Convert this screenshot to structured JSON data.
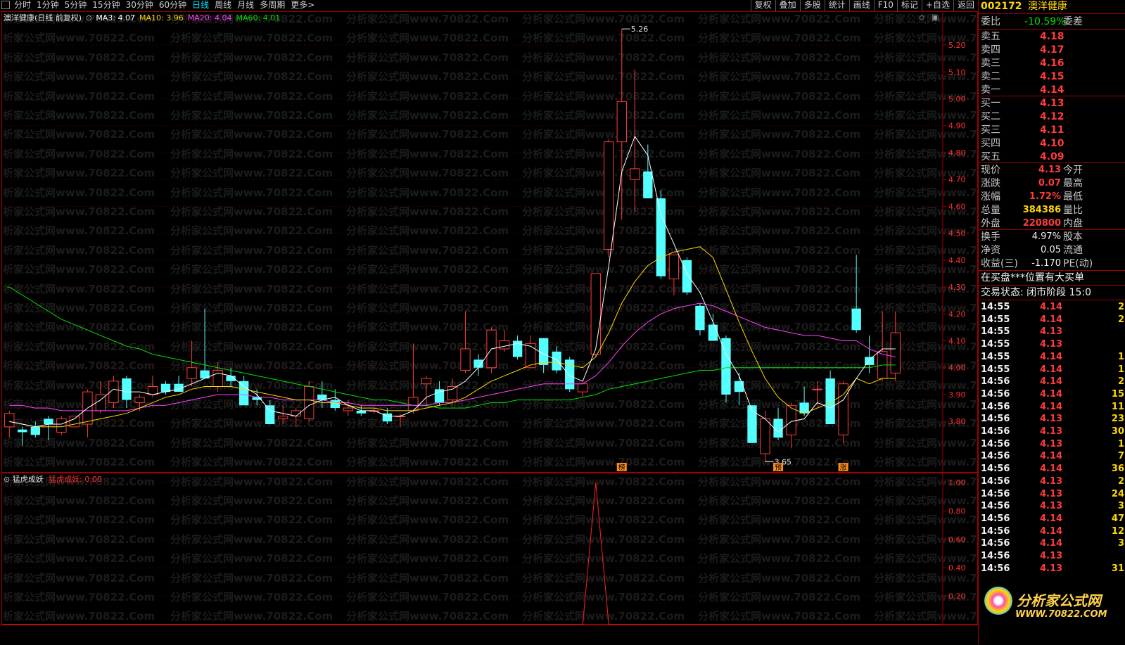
{
  "toolbar": {
    "periods": [
      "分时",
      "1分钟",
      "5分钟",
      "15分钟",
      "30分钟",
      "60分钟",
      "日线",
      "周线",
      "月线",
      "多周期",
      "更多>"
    ],
    "active_period": "日线",
    "tools": [
      "复权",
      "叠加",
      "多股",
      "统计",
      "画线",
      "F10",
      "标记",
      "+自选",
      "返回"
    ]
  },
  "main_chart": {
    "title": "澳洋健康(日线 前复权)",
    "ma_labels": [
      {
        "text": "MA3: 4.07",
        "color": "#ffffff"
      },
      {
        "text": "MA10: 3.96",
        "color": "#ffd700"
      },
      {
        "text": "MA20: 4.04",
        "color": "#ff40ff"
      },
      {
        "text": "MA60: 4.01",
        "color": "#00e000"
      }
    ],
    "y_ticks": [
      "5.20",
      "5.10",
      "5.00",
      "4.90",
      "4.80",
      "4.70",
      "4.60",
      "4.50",
      "4.40",
      "4.30",
      "4.20",
      "4.10",
      "4.00",
      "3.90",
      "3.80"
    ],
    "high_mark": "5.26",
    "low_mark": "3.65",
    "markers": [
      "榜",
      "预",
      "涨"
    ]
  },
  "indicator": {
    "title": "猛虎成妖",
    "value_label": "猛虎成妖: 0.00",
    "y_ticks": [
      "1.00",
      "0.80",
      "0.60",
      "0.40",
      "0.20"
    ]
  },
  "chart_data": {
    "type": "candlestick",
    "ylim": [
      3.62,
      5.31
    ],
    "candles": [
      {
        "o": 3.78,
        "h": 3.84,
        "l": 3.74,
        "c": 3.83
      },
      {
        "o": 3.77,
        "h": 3.78,
        "l": 3.71,
        "c": 3.76
      },
      {
        "o": 3.78,
        "h": 3.8,
        "l": 3.74,
        "c": 3.75
      },
      {
        "o": 3.81,
        "h": 3.82,
        "l": 3.73,
        "c": 3.79
      },
      {
        "o": 3.76,
        "h": 3.82,
        "l": 3.75,
        "c": 3.81
      },
      {
        "o": 3.78,
        "h": 3.82,
        "l": 3.78,
        "c": 3.82
      },
      {
        "o": 3.79,
        "h": 3.92,
        "l": 3.74,
        "c": 3.91
      },
      {
        "o": 3.84,
        "h": 3.95,
        "l": 3.83,
        "c": 3.9
      },
      {
        "o": 3.87,
        "h": 3.97,
        "l": 3.85,
        "c": 3.95
      },
      {
        "o": 3.96,
        "h": 3.97,
        "l": 3.85,
        "c": 3.88
      },
      {
        "o": 3.87,
        "h": 3.9,
        "l": 3.84,
        "c": 3.89
      },
      {
        "o": 3.9,
        "h": 3.97,
        "l": 3.89,
        "c": 3.93
      },
      {
        "o": 3.94,
        "h": 3.95,
        "l": 3.9,
        "c": 3.91
      },
      {
        "o": 3.94,
        "h": 3.97,
        "l": 3.91,
        "c": 3.91
      },
      {
        "o": 3.96,
        "h": 4.1,
        "l": 3.93,
        "c": 4.0
      },
      {
        "o": 3.99,
        "h": 4.22,
        "l": 3.97,
        "c": 3.96
      },
      {
        "o": 3.93,
        "h": 4.02,
        "l": 3.91,
        "c": 3.99
      },
      {
        "o": 3.97,
        "h": 4.0,
        "l": 3.93,
        "c": 3.95
      },
      {
        "o": 3.95,
        "h": 3.97,
        "l": 3.87,
        "c": 3.86
      },
      {
        "o": 3.89,
        "h": 3.92,
        "l": 3.86,
        "c": 3.88
      },
      {
        "o": 3.86,
        "h": 3.88,
        "l": 3.79,
        "c": 3.79
      },
      {
        "o": 3.81,
        "h": 3.86,
        "l": 3.79,
        "c": 3.82
      },
      {
        "o": 3.82,
        "h": 3.85,
        "l": 3.78,
        "c": 3.84
      },
      {
        "o": 3.81,
        "h": 3.95,
        "l": 3.8,
        "c": 3.93
      },
      {
        "o": 3.9,
        "h": 3.95,
        "l": 3.85,
        "c": 3.88
      },
      {
        "o": 3.88,
        "h": 3.92,
        "l": 3.84,
        "c": 3.85
      },
      {
        "o": 3.84,
        "h": 3.88,
        "l": 3.82,
        "c": 3.85
      },
      {
        "o": 3.84,
        "h": 3.86,
        "l": 3.82,
        "c": 3.83
      },
      {
        "o": 3.84,
        "h": 3.85,
        "l": 3.83,
        "c": 3.84
      },
      {
        "o": 3.83,
        "h": 3.85,
        "l": 3.79,
        "c": 3.8
      },
      {
        "o": 3.82,
        "h": 3.83,
        "l": 3.78,
        "c": 3.82
      },
      {
        "o": 3.84,
        "h": 4.09,
        "l": 3.83,
        "c": 3.89
      },
      {
        "o": 3.94,
        "h": 3.97,
        "l": 3.86,
        "c": 3.96
      },
      {
        "o": 3.92,
        "h": 3.95,
        "l": 3.86,
        "c": 3.87
      },
      {
        "o": 3.88,
        "h": 3.96,
        "l": 3.86,
        "c": 3.93
      },
      {
        "o": 3.99,
        "h": 4.21,
        "l": 3.98,
        "c": 4.07
      },
      {
        "o": 4.03,
        "h": 4.05,
        "l": 3.97,
        "c": 4.0
      },
      {
        "o": 4.0,
        "h": 4.15,
        "l": 3.98,
        "c": 4.14
      },
      {
        "o": 4.07,
        "h": 4.14,
        "l": 4.06,
        "c": 4.1
      },
      {
        "o": 4.1,
        "h": 4.12,
        "l": 4.03,
        "c": 4.04
      },
      {
        "o": 4.0,
        "h": 4.12,
        "l": 4.01,
        "c": 4.09
      },
      {
        "o": 4.11,
        "h": 4.11,
        "l": 3.98,
        "c": 4.01
      },
      {
        "o": 4.06,
        "h": 4.08,
        "l": 3.98,
        "c": 3.99
      },
      {
        "o": 4.03,
        "h": 4.04,
        "l": 3.91,
        "c": 3.92
      },
      {
        "o": 3.91,
        "h": 3.93,
        "l": 3.89,
        "c": 3.94
      },
      {
        "o": 4.05,
        "h": 4.35,
        "l": 4.04,
        "c": 4.35
      },
      {
        "o": 4.44,
        "h": 4.85,
        "l": 4.41,
        "c": 4.84
      },
      {
        "o": 4.84,
        "h": 5.26,
        "l": 4.55,
        "c": 4.99
      },
      {
        "o": 4.7,
        "h": 5.11,
        "l": 4.58,
        "c": 4.74
      },
      {
        "o": 4.73,
        "h": 4.83,
        "l": 4.65,
        "c": 4.63
      },
      {
        "o": 4.63,
        "h": 4.66,
        "l": 4.33,
        "c": 4.34
      },
      {
        "o": 4.33,
        "h": 4.36,
        "l": 4.27,
        "c": 4.42
      },
      {
        "o": 4.4,
        "h": 4.41,
        "l": 4.27,
        "c": 4.28
      },
      {
        "o": 4.23,
        "h": 4.24,
        "l": 4.12,
        "c": 4.14
      },
      {
        "o": 4.16,
        "h": 4.2,
        "l": 4.1,
        "c": 4.1
      },
      {
        "o": 4.11,
        "h": 4.12,
        "l": 3.87,
        "c": 3.9
      },
      {
        "o": 3.95,
        "h": 3.98,
        "l": 3.86,
        "c": 3.91
      },
      {
        "o": 3.86,
        "h": 3.86,
        "l": 3.74,
        "c": 3.72
      },
      {
        "o": 3.68,
        "h": 3.84,
        "l": 3.65,
        "c": 3.81
      },
      {
        "o": 3.81,
        "h": 3.85,
        "l": 3.73,
        "c": 3.74
      },
      {
        "o": 3.75,
        "h": 3.87,
        "l": 3.7,
        "c": 3.86
      },
      {
        "o": 3.87,
        "h": 3.93,
        "l": 3.82,
        "c": 3.83
      },
      {
        "o": 3.92,
        "h": 3.95,
        "l": 3.86,
        "c": 3.92
      },
      {
        "o": 3.96,
        "h": 3.99,
        "l": 3.82,
        "c": 3.79
      },
      {
        "o": 3.75,
        "h": 3.95,
        "l": 3.72,
        "c": 3.94
      },
      {
        "o": 4.22,
        "h": 4.42,
        "l": 4.13,
        "c": 4.14
      },
      {
        "o": 4.04,
        "h": 4.12,
        "l": 3.98,
        "c": 4.01
      },
      {
        "o": 3.96,
        "h": 4.21,
        "l": 3.95,
        "c": 4.06
      },
      {
        "o": 3.98,
        "h": 4.21,
        "l": 3.95,
        "c": 4.13
      }
    ],
    "ma3": [
      3.8,
      3.79,
      3.78,
      3.79,
      3.79,
      3.81,
      3.85,
      3.88,
      3.92,
      3.91,
      3.91,
      3.9,
      3.91,
      3.92,
      3.94,
      3.96,
      3.98,
      3.97,
      3.93,
      3.9,
      3.84,
      3.83,
      3.82,
      3.86,
      3.88,
      3.89,
      3.86,
      3.84,
      3.84,
      3.82,
      3.82,
      3.84,
      3.89,
      3.91,
      3.92,
      3.95,
      4.0,
      4.07,
      4.08,
      4.09,
      4.08,
      4.05,
      4.03,
      3.97,
      3.95,
      4.07,
      4.38,
      4.73,
      4.86,
      4.79,
      4.57,
      4.46,
      4.35,
      4.28,
      4.17,
      4.05,
      3.97,
      3.84,
      3.81,
      3.76,
      3.8,
      3.81,
      3.87,
      3.85,
      3.88,
      3.96,
      4.03,
      4.07,
      4.07
    ],
    "ma10": [
      3.8,
      3.79,
      3.78,
      3.78,
      3.78,
      3.79,
      3.8,
      3.81,
      3.82,
      3.83,
      3.85,
      3.87,
      3.89,
      3.9,
      3.92,
      3.93,
      3.93,
      3.93,
      3.92,
      3.91,
      3.9,
      3.89,
      3.88,
      3.88,
      3.87,
      3.87,
      3.86,
      3.85,
      3.85,
      3.84,
      3.84,
      3.84,
      3.85,
      3.86,
      3.87,
      3.89,
      3.92,
      3.95,
      3.97,
      3.99,
      4.01,
      4.02,
      4.02,
      4.01,
      4.0,
      4.04,
      4.13,
      4.24,
      4.32,
      4.38,
      4.41,
      4.43,
      4.44,
      4.45,
      4.41,
      4.29,
      4.17,
      4.06,
      3.96,
      3.89,
      3.85,
      3.83,
      3.85,
      3.87,
      3.9,
      3.96,
      3.94,
      3.96,
      3.96
    ],
    "ma20": [
      3.86,
      3.86,
      3.85,
      3.85,
      3.84,
      3.84,
      3.84,
      3.84,
      3.84,
      3.84,
      3.85,
      3.86,
      3.86,
      3.87,
      3.88,
      3.89,
      3.9,
      3.9,
      3.9,
      3.89,
      3.89,
      3.88,
      3.88,
      3.88,
      3.88,
      3.87,
      3.87,
      3.86,
      3.86,
      3.86,
      3.86,
      3.86,
      3.86,
      3.87,
      3.87,
      3.88,
      3.89,
      3.9,
      3.91,
      3.92,
      3.93,
      3.94,
      3.94,
      3.94,
      3.94,
      3.97,
      4.02,
      4.08,
      4.13,
      4.17,
      4.2,
      4.22,
      4.23,
      4.24,
      4.23,
      4.21,
      4.19,
      4.17,
      4.15,
      4.14,
      4.13,
      4.12,
      4.12,
      4.11,
      4.1,
      4.1,
      4.07,
      4.05,
      4.04
    ],
    "ma60": [
      4.3,
      4.27,
      4.24,
      4.21,
      4.18,
      4.16,
      4.14,
      4.12,
      4.1,
      4.08,
      4.07,
      4.05,
      4.04,
      4.03,
      4.02,
      4.01,
      4.0,
      3.99,
      3.98,
      3.97,
      3.96,
      3.95,
      3.94,
      3.93,
      3.92,
      3.91,
      3.9,
      3.89,
      3.88,
      3.88,
      3.87,
      3.86,
      3.86,
      3.85,
      3.85,
      3.85,
      3.86,
      3.87,
      3.87,
      3.88,
      3.88,
      3.88,
      3.88,
      3.88,
      3.89,
      3.9,
      3.92,
      3.93,
      3.94,
      3.95,
      3.96,
      3.97,
      3.98,
      3.99,
      3.99,
      4.0,
      4.0,
      4.0,
      4.0,
      4.0,
      4.0,
      4.0,
      4.0,
      4.0,
      4.0,
      4.0,
      4.0,
      4.01,
      4.01
    ],
    "indicator_ylim": [
      0,
      1.05
    ],
    "indicator_spike": {
      "index": 45,
      "value": 1.0
    }
  },
  "panel": {
    "code": "002172",
    "name": "澳洋健康",
    "weibi_label": "委比",
    "weibi_value": "-10.59%",
    "weicha_label": "委差",
    "asks": [
      {
        "label": "卖五",
        "price": "4.18"
      },
      {
        "label": "卖四",
        "price": "4.17"
      },
      {
        "label": "卖三",
        "price": "4.16"
      },
      {
        "label": "卖二",
        "price": "4.15"
      },
      {
        "label": "卖一",
        "price": "4.14"
      }
    ],
    "bids": [
      {
        "label": "买一",
        "price": "4.13"
      },
      {
        "label": "买二",
        "price": "4.12"
      },
      {
        "label": "买三",
        "price": "4.11"
      },
      {
        "label": "买四",
        "price": "4.10"
      },
      {
        "label": "买五",
        "price": "4.09"
      }
    ],
    "stats": [
      {
        "l": "现价",
        "v": "4.13",
        "c": "red",
        "r": "今开"
      },
      {
        "l": "涨跌",
        "v": "0.07",
        "c": "red",
        "r": "最高"
      },
      {
        "l": "涨幅",
        "v": "1.72%",
        "c": "red",
        "r": "最低"
      },
      {
        "l": "总量",
        "v": "384386",
        "c": "yellow",
        "r": "量比"
      },
      {
        "l": "外盘",
        "v": "220800",
        "c": "red",
        "r": "内盘"
      }
    ],
    "stats2": [
      {
        "l": "换手",
        "v": "4.97%",
        "r": "股本"
      },
      {
        "l": "净资",
        "v": "0.05",
        "r": "流通"
      },
      {
        "l": "收益(三)",
        "v": "-1.170",
        "r": "PE(动)"
      }
    ],
    "news": "在买盘***位置有大买单",
    "trade_status": "交易状态: 闭市阶段 15:0",
    "ticks": [
      {
        "t": "14:55",
        "p": "4.14",
        "c": "red",
        "v": "2"
      },
      {
        "t": "14:55",
        "p": "4.14",
        "c": "red",
        "v": "2"
      },
      {
        "t": "14:55",
        "p": "4.13",
        "c": "red",
        "v": ""
      },
      {
        "t": "14:55",
        "p": "4.13",
        "c": "red",
        "v": ""
      },
      {
        "t": "14:55",
        "p": "4.14",
        "c": "red",
        "v": "1"
      },
      {
        "t": "14:55",
        "p": "4.14",
        "c": "red",
        "v": "1"
      },
      {
        "t": "14:56",
        "p": "4.14",
        "c": "red",
        "v": "2"
      },
      {
        "t": "14:56",
        "p": "4.14",
        "c": "red",
        "v": "15"
      },
      {
        "t": "14:56",
        "p": "4.14",
        "c": "red",
        "v": "11"
      },
      {
        "t": "14:56",
        "p": "4.13",
        "c": "red",
        "v": "23"
      },
      {
        "t": "14:56",
        "p": "4.13",
        "c": "red",
        "v": "30"
      },
      {
        "t": "14:56",
        "p": "4.13",
        "c": "red",
        "v": "1"
      },
      {
        "t": "14:56",
        "p": "4.14",
        "c": "red",
        "v": "7"
      },
      {
        "t": "14:56",
        "p": "4.14",
        "c": "red",
        "v": "36"
      },
      {
        "t": "14:56",
        "p": "4.13",
        "c": "red",
        "v": "2"
      },
      {
        "t": "14:56",
        "p": "4.13",
        "c": "red",
        "v": "24"
      },
      {
        "t": "14:56",
        "p": "4.13",
        "c": "red",
        "v": "3"
      },
      {
        "t": "14:56",
        "p": "4.14",
        "c": "red",
        "v": "47"
      },
      {
        "t": "14:56",
        "p": "4.14",
        "c": "red",
        "v": "12"
      },
      {
        "t": "14:56",
        "p": "4.14",
        "c": "red",
        "v": "3"
      },
      {
        "t": "14:56",
        "p": "4.13",
        "c": "red",
        "v": ""
      },
      {
        "t": "14:56",
        "p": "4.13",
        "c": "red",
        "v": "31"
      }
    ],
    "logo_text": "分析家公式网",
    "logo_url": "WWW.70822.COM"
  },
  "watermark": {
    "text_a": "分析家公式网www.70822.Com",
    "text_b": "析家公式网www.70822.Com"
  }
}
